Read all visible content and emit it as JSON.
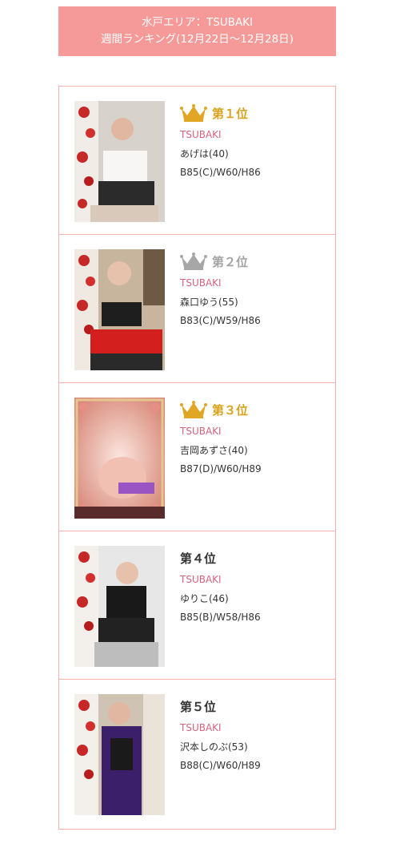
{
  "header": {
    "line1": "水戸エリア：TSUBAKI",
    "line2": "週間ランキング(12月22日〜12月28日)"
  },
  "colors": {
    "header_bg": "#f59a98",
    "border": "#f6b0ae",
    "gold": "#d9a21b",
    "silver": "#a3a3a3",
    "shop": "#d1657f"
  },
  "ranking": [
    {
      "rank_label": "第１位",
      "crown": "gold-crown-icon",
      "shop": "TSUBAKI",
      "name": "あげは(40)",
      "size": "B85(C)/W60/H86"
    },
    {
      "rank_label": "第２位",
      "crown": "silver-crown-icon",
      "shop": "TSUBAKI",
      "name": "森口ゆう(55)",
      "size": "B83(C)/W59/H86"
    },
    {
      "rank_label": "第３位",
      "crown": "bronze-crown-icon",
      "shop": "TSUBAKI",
      "name": "吉岡あずさ(40)",
      "size": "B87(D)/W60/H89"
    },
    {
      "rank_label": "第４位",
      "crown": null,
      "shop": "TSUBAKI",
      "name": "ゆりこ(46)",
      "size": "B85(B)/W58/H86"
    },
    {
      "rank_label": "第５位",
      "crown": null,
      "shop": "TSUBAKI",
      "name": "沢本しのぶ(53)",
      "size": "B88(C)/W60/H89"
    }
  ]
}
